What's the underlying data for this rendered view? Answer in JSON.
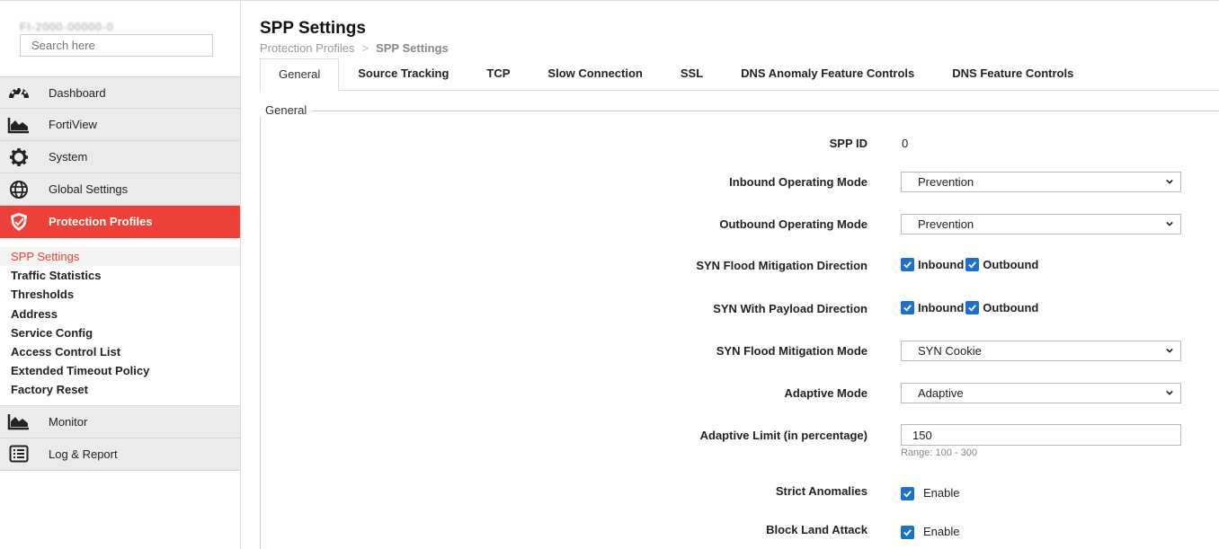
{
  "sidebar": {
    "hostname": "FI-2000-00000-0",
    "search_placeholder": "Search here",
    "menu_top": [
      {
        "label": "Dashboard",
        "icon": "dashboard-icon"
      },
      {
        "label": "FortiView",
        "icon": "area-chart-icon"
      },
      {
        "label": "System",
        "icon": "gear-icon"
      },
      {
        "label": "Global Settings",
        "icon": "globe-icon"
      },
      {
        "label": "Protection Profiles",
        "icon": "shield-icon"
      }
    ],
    "submenu": [
      "SPP Settings",
      "Traffic Statistics",
      "Thresholds",
      "Address",
      "Service Config",
      "Access Control List",
      "Extended Timeout Policy",
      "Factory Reset"
    ],
    "menu_bottom": [
      {
        "label": "Monitor",
        "icon": "area-chart-icon"
      },
      {
        "label": "Log & Report",
        "icon": "list-icon"
      }
    ]
  },
  "header": {
    "title": "SPP Settings",
    "breadcrumb": [
      "Protection Profiles",
      ">",
      "SPP Settings"
    ]
  },
  "tabs": [
    "General",
    "Source Tracking",
    "TCP",
    "Slow Connection",
    "SSL",
    "DNS Anomaly Feature Controls",
    "DNS Feature Controls"
  ],
  "general": {
    "legend": "General",
    "spp_id": {
      "label": "SPP ID",
      "value": "0"
    },
    "inbound_mode": {
      "label": "Inbound Operating Mode",
      "value": "Prevention"
    },
    "outbound_mode": {
      "label": "Outbound Operating Mode",
      "value": "Prevention"
    },
    "syn_flood_direction": {
      "label": "SYN Flood Mitigation Direction",
      "inbound": "Inbound",
      "outbound": "Outbound"
    },
    "syn_payload_direction": {
      "label": "SYN With Payload Direction",
      "inbound": "Inbound",
      "outbound": "Outbound"
    },
    "syn_flood_mode": {
      "label": "SYN Flood Mitigation Mode",
      "value": "SYN Cookie"
    },
    "adaptive_mode": {
      "label": "Adaptive Mode",
      "value": "Adaptive"
    },
    "adaptive_limit": {
      "label": "Adaptive Limit (in percentage)",
      "value": "150",
      "hint": "Range: 100 - 300"
    },
    "strict_anomalies": {
      "label": "Strict Anomalies",
      "option": "Enable"
    },
    "block_land_attack": {
      "label": "Block Land Attack",
      "option": "Enable"
    }
  },
  "colors": {
    "accent": "#ee4036",
    "checkbox": "#1a73c8"
  }
}
